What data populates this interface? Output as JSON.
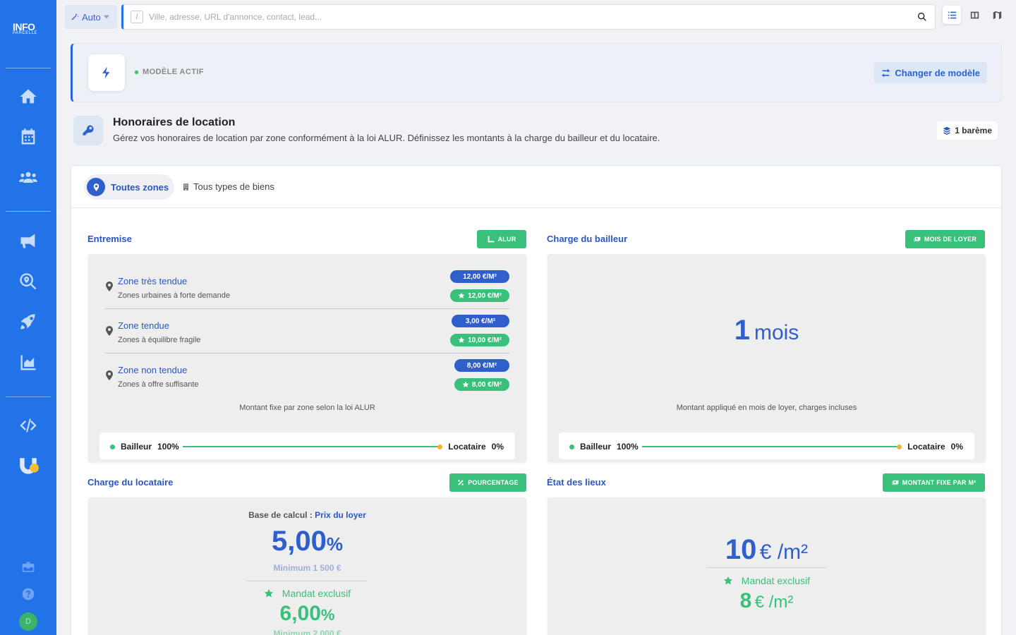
{
  "app": {
    "logo_line1": "INFO",
    "logo_line2": "PARCELLE"
  },
  "topbar": {
    "mode_label": "Auto",
    "search_shortcut": "/",
    "search_placeholder": "Ville, adresse, URL d'annonce, contact, lead..."
  },
  "sidebar": {
    "icons": [
      "home-icon",
      "calendar-icon",
      "users-icon",
      "megaphone-icon",
      "search-location-icon",
      "rocket-icon",
      "chart-area-icon",
      "code-icon",
      "magnet-icon",
      "toolbox-icon",
      "help-icon"
    ],
    "avatar_initial": "D"
  },
  "model": {
    "status": "MODÈLE ACTIF",
    "change_label": "Changer de modèle"
  },
  "header": {
    "title": "Honoraires de location",
    "subtitle": "Gérez vos honoraires de location par zone conformément à la loi ALUR. Définissez les montants à la charge du bailleur et du locataire.",
    "bareme": "1 barème"
  },
  "filters": {
    "zone": "Toutes zones",
    "types": "Tous types de biens"
  },
  "entremise": {
    "title": "Entremise",
    "badge": "ALUR",
    "zones": [
      {
        "name": "Zone très tendue",
        "desc": "Zones urbaines à forte demande",
        "price": "12,00 €/M²",
        "exclusive": "12,00 €/M²"
      },
      {
        "name": "Zone tendue",
        "desc": "Zones à équilibre fragile",
        "price": "3,00 €/M²",
        "exclusive": "10,00 €/M²"
      },
      {
        "name": "Zone non tendue",
        "desc": "Zones à offre suffisante",
        "price": "8,00 €/M²",
        "exclusive": "8,00 €/M²"
      }
    ],
    "note": "Montant fixe par zone selon la loi ALUR",
    "split": {
      "bailleur_label": "Bailleur",
      "bailleur_pct": "100%",
      "locataire_label": "Locataire",
      "locataire_pct": "0%"
    }
  },
  "bailleur": {
    "title": "Charge du bailleur",
    "badge": "MOIS DE LOYER",
    "value": "1",
    "unit": "mois",
    "note": "Montant appliqué en mois de loyer, charges incluses",
    "split": {
      "bailleur_label": "Bailleur",
      "bailleur_pct": "100%",
      "locataire_label": "Locataire",
      "locataire_pct": "0%"
    }
  },
  "locataire": {
    "title": "Charge du locataire",
    "badge": "POURCENTAGE",
    "base_label": "Base de calcul :",
    "base_value": "Prix du loyer",
    "value": "5,00",
    "unit": "%",
    "minimum": "Minimum 1 500 €",
    "exclusive_label": "Mandat exclusif",
    "exclusive_value": "6,00",
    "exclusive_unit": "%",
    "exclusive_minimum": "Minimum 2 000 €"
  },
  "etat": {
    "title": "État des lieux",
    "badge": "MONTANT FIXE PAR M²",
    "value": "10",
    "unit": "€ /m²",
    "exclusive_label": "Mandat exclusif",
    "exclusive_value": "8",
    "exclusive_unit": "€ /m²"
  },
  "colors": {
    "sidebar": "#2273e8",
    "accent_blue": "#2e5fcc",
    "accent_green": "#39c07a",
    "yellow": "#f1b72e"
  }
}
